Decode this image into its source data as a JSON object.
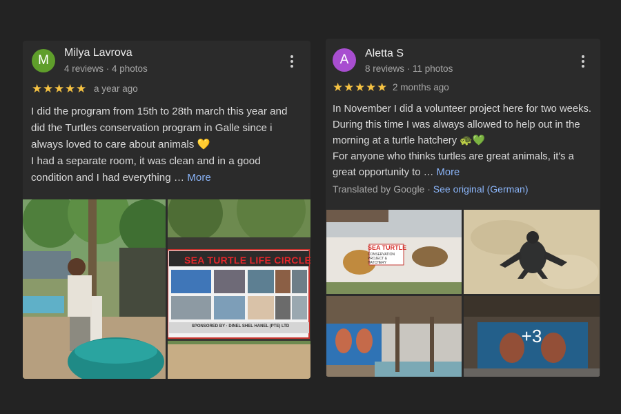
{
  "reviews": [
    {
      "avatar_letter": "M",
      "avatar_color": "#5f9e2b",
      "name": "Milya Lavrova",
      "meta": "4 reviews · 4 photos",
      "rating": 5,
      "when": "a year ago",
      "text": "I did the program from 15th to 28th march this year and did the Turtles conservation program in Galle since i always loved to care about animals ",
      "text_emoji": "💛",
      "text2": "\nI had a separate room, it was clean and in a good condition and I had everything … ",
      "more_label": "More"
    },
    {
      "avatar_letter": "A",
      "avatar_color": "#a84ed0",
      "name": "Aletta S",
      "meta": "8 reviews · 11 photos",
      "rating": 5,
      "when": "2 months ago",
      "text": "In November I did a volunteer project here for two weeks. During this time I was always allowed to help out in the morning at a turtle hatchery ",
      "text_emoji": "🐢💚",
      "text2": "\nFor anyone who thinks turtles are great animals, it's a great opportunity to … ",
      "more_label": "More",
      "translated_label": "Translated by Google · ",
      "see_original_label": "See original (German)"
    }
  ],
  "photos": {
    "sign_title": "SEA TURTLE LIFE CIRCLE",
    "sign_sponsor": "SPONSORED BY · DINEL SHEL HANEL (PTE) LTD",
    "wall_title": "SEA TURTLE",
    "wall_sub": "CONSERVATION PROJECT & HATCHERY",
    "more_count": "+3"
  }
}
